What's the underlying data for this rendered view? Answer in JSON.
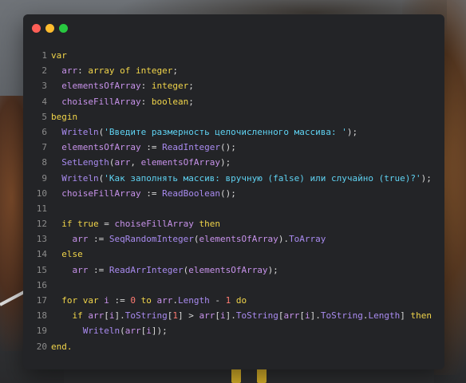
{
  "window": {
    "traffic_lights": [
      "#ff5f57",
      "#febc2e",
      "#28c840"
    ]
  },
  "code": {
    "lines": [
      {
        "n": "1",
        "tokens": [
          {
            "t": "kw",
            "v": "var"
          }
        ]
      },
      {
        "n": "2",
        "tokens": [
          {
            "t": "sp",
            "v": "  "
          },
          {
            "t": "id",
            "v": "arr"
          },
          {
            "t": "op",
            "v": ": "
          },
          {
            "t": "kw",
            "v": "array"
          },
          {
            "t": "op",
            "v": " "
          },
          {
            "t": "kw",
            "v": "of"
          },
          {
            "t": "op",
            "v": " "
          },
          {
            "t": "kw",
            "v": "integer"
          },
          {
            "t": "op",
            "v": ";"
          }
        ]
      },
      {
        "n": "3",
        "tokens": [
          {
            "t": "sp",
            "v": "  "
          },
          {
            "t": "id",
            "v": "elementsOfArray"
          },
          {
            "t": "op",
            "v": ": "
          },
          {
            "t": "kw",
            "v": "integer"
          },
          {
            "t": "op",
            "v": ";"
          }
        ]
      },
      {
        "n": "4",
        "tokens": [
          {
            "t": "sp",
            "v": "  "
          },
          {
            "t": "id",
            "v": "choiseFillArray"
          },
          {
            "t": "op",
            "v": ": "
          },
          {
            "t": "kw",
            "v": "boolean"
          },
          {
            "t": "op",
            "v": ";"
          }
        ]
      },
      {
        "n": "5",
        "tokens": [
          {
            "t": "kw",
            "v": "begin"
          }
        ]
      },
      {
        "n": "6",
        "tokens": [
          {
            "t": "sp",
            "v": "  "
          },
          {
            "t": "fn",
            "v": "Writeln"
          },
          {
            "t": "op",
            "v": "("
          },
          {
            "t": "str",
            "v": "'Введите размерность целочисленного массива: '"
          },
          {
            "t": "op",
            "v": ");"
          }
        ]
      },
      {
        "n": "7",
        "tokens": [
          {
            "t": "sp",
            "v": "  "
          },
          {
            "t": "id",
            "v": "elementsOfArray"
          },
          {
            "t": "op",
            "v": " := "
          },
          {
            "t": "fn",
            "v": "ReadInteger"
          },
          {
            "t": "op",
            "v": "();"
          }
        ]
      },
      {
        "n": "8",
        "tokens": [
          {
            "t": "sp",
            "v": "  "
          },
          {
            "t": "fn",
            "v": "SetLength"
          },
          {
            "t": "op",
            "v": "("
          },
          {
            "t": "id",
            "v": "arr"
          },
          {
            "t": "op",
            "v": ", "
          },
          {
            "t": "id",
            "v": "elementsOfArray"
          },
          {
            "t": "op",
            "v": ");"
          }
        ]
      },
      {
        "n": "9",
        "tokens": [
          {
            "t": "sp",
            "v": "  "
          },
          {
            "t": "fn",
            "v": "Writeln"
          },
          {
            "t": "op",
            "v": "("
          },
          {
            "t": "str",
            "v": "'Как заполнять массив: вручную (false) или случайно (true)?'"
          },
          {
            "t": "op",
            "v": ");"
          }
        ]
      },
      {
        "n": "10",
        "tokens": [
          {
            "t": "sp",
            "v": "  "
          },
          {
            "t": "id",
            "v": "choiseFillArray"
          },
          {
            "t": "op",
            "v": " := "
          },
          {
            "t": "fn",
            "v": "ReadBoolean"
          },
          {
            "t": "op",
            "v": "();"
          }
        ]
      },
      {
        "n": "11",
        "tokens": []
      },
      {
        "n": "12",
        "tokens": [
          {
            "t": "sp",
            "v": "  "
          },
          {
            "t": "kw",
            "v": "if"
          },
          {
            "t": "op",
            "v": " "
          },
          {
            "t": "kw",
            "v": "true"
          },
          {
            "t": "op",
            "v": " = "
          },
          {
            "t": "id",
            "v": "choiseFillArray"
          },
          {
            "t": "op",
            "v": " "
          },
          {
            "t": "kw",
            "v": "then"
          }
        ]
      },
      {
        "n": "13",
        "tokens": [
          {
            "t": "sp",
            "v": "    "
          },
          {
            "t": "id",
            "v": "arr"
          },
          {
            "t": "op",
            "v": " := "
          },
          {
            "t": "fn",
            "v": "SeqRandomInteger"
          },
          {
            "t": "op",
            "v": "("
          },
          {
            "t": "id",
            "v": "elementsOfArray"
          },
          {
            "t": "op",
            "v": ")."
          },
          {
            "t": "fn",
            "v": "ToArray"
          }
        ]
      },
      {
        "n": "14",
        "tokens": [
          {
            "t": "sp",
            "v": "  "
          },
          {
            "t": "kw",
            "v": "else"
          }
        ]
      },
      {
        "n": "15",
        "tokens": [
          {
            "t": "sp",
            "v": "    "
          },
          {
            "t": "id",
            "v": "arr"
          },
          {
            "t": "op",
            "v": " := "
          },
          {
            "t": "fn",
            "v": "ReadArrInteger"
          },
          {
            "t": "op",
            "v": "("
          },
          {
            "t": "id",
            "v": "elementsOfArray"
          },
          {
            "t": "op",
            "v": ");"
          }
        ]
      },
      {
        "n": "16",
        "tokens": []
      },
      {
        "n": "17",
        "tokens": [
          {
            "t": "sp",
            "v": "  "
          },
          {
            "t": "kw",
            "v": "for"
          },
          {
            "t": "op",
            "v": " "
          },
          {
            "t": "kw",
            "v": "var"
          },
          {
            "t": "op",
            "v": " "
          },
          {
            "t": "id",
            "v": "i"
          },
          {
            "t": "op",
            "v": " := "
          },
          {
            "t": "num",
            "v": "0"
          },
          {
            "t": "op",
            "v": " "
          },
          {
            "t": "kw",
            "v": "to"
          },
          {
            "t": "op",
            "v": " "
          },
          {
            "t": "id",
            "v": "arr"
          },
          {
            "t": "op",
            "v": "."
          },
          {
            "t": "fn",
            "v": "Length"
          },
          {
            "t": "op",
            "v": " - "
          },
          {
            "t": "num",
            "v": "1"
          },
          {
            "t": "op",
            "v": " "
          },
          {
            "t": "kw",
            "v": "do"
          }
        ]
      },
      {
        "n": "18",
        "tokens": [
          {
            "t": "sp",
            "v": "    "
          },
          {
            "t": "kw",
            "v": "if"
          },
          {
            "t": "op",
            "v": " "
          },
          {
            "t": "id",
            "v": "arr"
          },
          {
            "t": "op",
            "v": "["
          },
          {
            "t": "id",
            "v": "i"
          },
          {
            "t": "op",
            "v": "]."
          },
          {
            "t": "fn",
            "v": "ToString"
          },
          {
            "t": "op",
            "v": "["
          },
          {
            "t": "num",
            "v": "1"
          },
          {
            "t": "op",
            "v": "] > "
          },
          {
            "t": "id",
            "v": "arr"
          },
          {
            "t": "op",
            "v": "["
          },
          {
            "t": "id",
            "v": "i"
          },
          {
            "t": "op",
            "v": "]."
          },
          {
            "t": "fn",
            "v": "ToString"
          },
          {
            "t": "op",
            "v": "["
          },
          {
            "t": "id",
            "v": "arr"
          },
          {
            "t": "op",
            "v": "["
          },
          {
            "t": "id",
            "v": "i"
          },
          {
            "t": "op",
            "v": "]."
          },
          {
            "t": "fn",
            "v": "ToString"
          },
          {
            "t": "op",
            "v": "."
          },
          {
            "t": "fn",
            "v": "Length"
          },
          {
            "t": "op",
            "v": "] "
          },
          {
            "t": "kw",
            "v": "then"
          }
        ]
      },
      {
        "n": "19",
        "tokens": [
          {
            "t": "sp",
            "v": "      "
          },
          {
            "t": "fn",
            "v": "Writeln"
          },
          {
            "t": "op",
            "v": "("
          },
          {
            "t": "id",
            "v": "arr"
          },
          {
            "t": "op",
            "v": "["
          },
          {
            "t": "id",
            "v": "i"
          },
          {
            "t": "op",
            "v": "]);"
          }
        ]
      },
      {
        "n": "20",
        "tokens": [
          {
            "t": "kw",
            "v": "end."
          }
        ]
      }
    ]
  }
}
